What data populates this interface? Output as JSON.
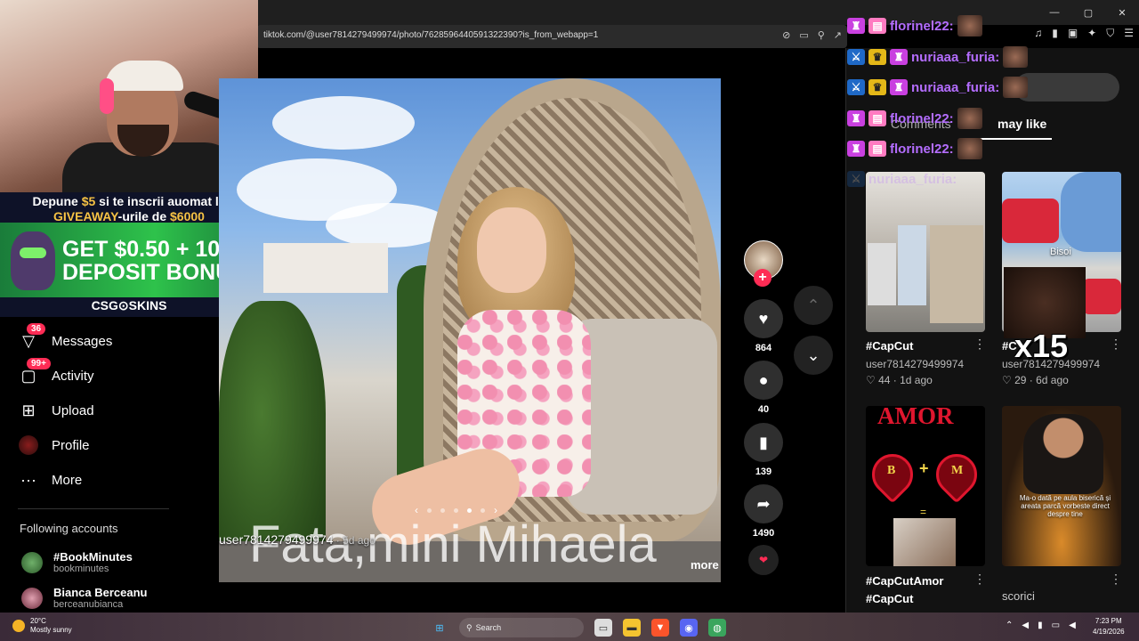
{
  "browser": {
    "url": "tiktok.com/@user7814279499974/photo/7628596440591322390?is_from_webapp=1",
    "window_controls": [
      "—",
      "▢",
      "✕"
    ]
  },
  "stream_overlay": {
    "promo_line1_pre": "Depune ",
    "promo_line1_amount": "$5",
    "promo_line1_post": " si te inscrii auomat la",
    "promo_line2_pre": "GIVEAWAY",
    "promo_line2_mid": "-urile de ",
    "promo_line2_amount": "$6000",
    "promo_big1": "GET $0.50 + 10%",
    "promo_big2": "DEPOSIT BONUS",
    "promo_brand": "CSG⊙SKINS"
  },
  "sidebar": {
    "items": [
      {
        "label": "Messages",
        "badge": "36"
      },
      {
        "label": "Activity",
        "badge": "99+"
      },
      {
        "label": "Upload"
      },
      {
        "label": "Profile"
      },
      {
        "label": "More"
      }
    ],
    "following_heading": "Following accounts",
    "accounts": [
      {
        "name": "#BookMinutes",
        "handle": "bookminutes"
      },
      {
        "name": "Bianca Berceanu",
        "handle": "berceanubianca"
      }
    ]
  },
  "post": {
    "caption": "Fata,mini Mihaela",
    "username": "user7814279499974",
    "ago": " · 5d ago",
    "more_label": "more",
    "pager_prev": "‹",
    "pager_next": "›",
    "actions": {
      "likes": "864",
      "comments": "40",
      "saves": "139",
      "shares": "1490"
    }
  },
  "right_panel": {
    "tab_comments": "Comments",
    "tab_you_may_like": "may like",
    "cards": [
      {
        "title": "#CapCut",
        "user": "user7814279499974",
        "likes": "44",
        "ago": "1d ago"
      },
      {
        "title": "#C",
        "user": "user7814279499974",
        "likes": "29",
        "ago": "6d ago"
      },
      {
        "title": "#CapCutAmor",
        "title2": "#CapCut"
      },
      {
        "title": "scorici"
      }
    ],
    "amor_text": "AMOR",
    "heart_left": "B",
    "heart_right": "M",
    "thumb4_text": "Ma-o dată pe aula biserică și\nareata parcă vorbeste direct\ndespre tine",
    "overlay_x15": "x15",
    "bisoi_label": "Bisoi"
  },
  "chat": [
    {
      "user": "florinel22:",
      "badges": [
        "sub",
        "gift"
      ]
    },
    {
      "user": "nuriaaa_furia:",
      "badges": [
        "sword",
        "crown",
        "sub"
      ]
    },
    {
      "user": "nuriaaa_furia:",
      "badges": [
        "sword",
        "crown",
        "sub"
      ]
    },
    {
      "user": "florinel22:",
      "badges": [
        "sub",
        "gift"
      ]
    },
    {
      "user": "florinel22:",
      "badges": [
        "sub",
        "gift"
      ]
    },
    {
      "user": "nuriaaa_furia:",
      "badges": [
        "sword"
      ]
    }
  ],
  "taskbar": {
    "weather_temp": "20°C",
    "weather_desc": "Mostly sunny",
    "search_label": "Search",
    "time": "7:23 PM",
    "date": "4/19/2026"
  },
  "colors": {
    "tiktok_red": "#fe2c55",
    "chat_purple": "#b46dff",
    "amor_red": "#e0162e"
  }
}
